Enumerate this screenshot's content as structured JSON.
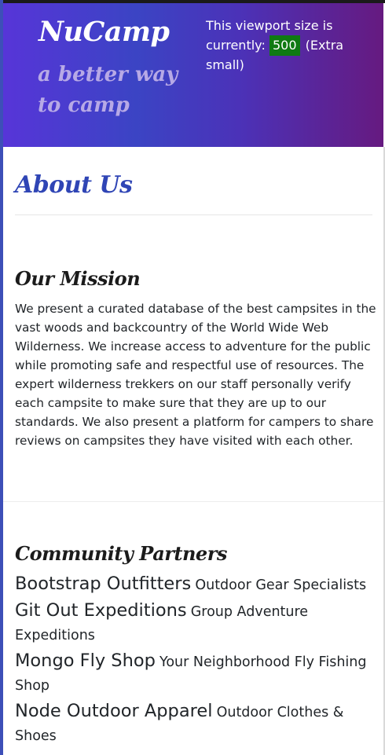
{
  "header": {
    "brand": "NuCamp",
    "tagline": "a better way to camp",
    "viewport_prefix": "This viewport size is currently:",
    "viewport_value": "500",
    "viewport_suffix": "(Extra small)"
  },
  "page": {
    "title": "About Us"
  },
  "mission": {
    "heading": "Our Mission",
    "text": "We present a curated database of the best campsites in the vast woods and backcountry of the World Wide Web Wilderness. We increase access to adventure for the public while promoting safe and respectful use of resources. The expert wilderness trekkers on our staff personally verify each campsite to make sure that they are up to our standards. We also present a platform for campers to share reviews on campsites they have visited with each other."
  },
  "partners": {
    "heading": "Community Partners",
    "items": [
      {
        "name": "Bootstrap Outfitters",
        "description": "Outdoor Gear Specialists"
      },
      {
        "name": "Git Out Expeditions",
        "description": "Group Adventure Expeditions"
      },
      {
        "name": "Mongo Fly Shop",
        "description": "Your Neighborhood Fly Fishing Shop"
      },
      {
        "name": "Node Outdoor Apparel",
        "description": "Outdoor Clothes & Shoes"
      }
    ]
  },
  "colors": {
    "badge": "#0f7a13",
    "title_blue": "#2f45b5",
    "gradient_start": "#5735d8",
    "gradient_end": "#661a80"
  }
}
